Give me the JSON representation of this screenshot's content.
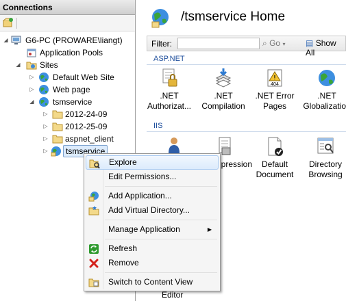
{
  "connections": {
    "title": "Connections",
    "tree": {
      "server": "G6-PC (PROWARE\\liangt)",
      "app_pools": "Application Pools",
      "sites": "Sites",
      "default_site": "Default Web Site",
      "web_page": "Web page",
      "tsmservice": "tsmservice",
      "folders": [
        "2012-24-09",
        "2012-25-09",
        "aspnet_client"
      ],
      "selected_app": "tsmservice"
    }
  },
  "home": {
    "title": "/tsmservice Home",
    "filter_label": "Filter:",
    "filter_value": "",
    "go_label": "Go",
    "show_all_label": "Show All",
    "groups": {
      "aspnet": {
        "title": "ASP.NET",
        "items": [
          {
            "label": ".NET Authorizat...",
            "icon": "lock-icon"
          },
          {
            "label": ".NET Compilation",
            "icon": "compilation-icon"
          },
          {
            "label": ".NET Error Pages",
            "icon": "error-404-icon"
          },
          {
            "label": ".NET Globalization",
            "icon": "globe-icon"
          }
        ]
      },
      "iis": {
        "title": "IIS",
        "items": [
          {
            "label": "...pression",
            "icon": "compression-icon"
          },
          {
            "label": "Default Document",
            "icon": "default-document-icon"
          },
          {
            "label": "Directory Browsing",
            "icon": "directory-browsing-icon"
          }
        ],
        "partial_bottom_label": "Editor"
      }
    }
  },
  "context_menu": {
    "items": [
      {
        "label": "Explore",
        "icon": "explore-icon",
        "highlighted": true
      },
      {
        "label": "Edit Permissions...",
        "icon": ""
      },
      {
        "label": "Add Application...",
        "icon": "add-application-icon"
      },
      {
        "label": "Add Virtual Directory...",
        "icon": "add-virtual-directory-icon"
      },
      {
        "label": "Manage Application",
        "icon": "",
        "submenu": true
      },
      {
        "label": "Refresh",
        "icon": "refresh-icon"
      },
      {
        "label": "Remove",
        "icon": "remove-icon"
      },
      {
        "label": "Switch to Content View",
        "icon": "content-view-icon"
      }
    ]
  },
  "colors": {
    "group_title": "#1f4f9c",
    "selection_bg": "#dcebfc",
    "selection_border": "#7da2ce",
    "remove_red": "#d4221c",
    "refresh_green": "#2e9a2e"
  }
}
